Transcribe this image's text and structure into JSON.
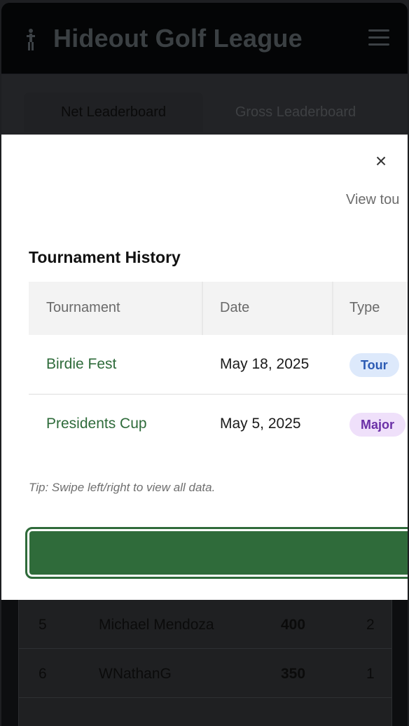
{
  "header": {
    "title": "Hideout Golf League",
    "logo_icon": "golfer-icon",
    "menu_icon": "hamburger-menu-icon"
  },
  "tabs": [
    {
      "label": "Net Leaderboard",
      "active": true
    },
    {
      "label": "Gross Leaderboard",
      "active": false
    }
  ],
  "leaderboard": {
    "rows": [
      {
        "rank": "5",
        "name": "Michael Mendoza",
        "points": "400",
        "events": "2"
      },
      {
        "rank": "6",
        "name": "WNathanG",
        "points": "350",
        "events": "1"
      }
    ]
  },
  "modal": {
    "close_symbol": "×",
    "view_link": "View tou",
    "section_title": "Tournament History",
    "columns": [
      "Tournament",
      "Date",
      "Type"
    ],
    "rows": [
      {
        "tournament": "Birdie Fest",
        "date": "May 18, 2025",
        "type": "Tour"
      },
      {
        "tournament": "Presidents Cup",
        "date": "May 5, 2025",
        "type": "Major"
      }
    ],
    "tip": "Tip: Swipe left/right to view all data.",
    "colors": {
      "accent": "#2f6b3a",
      "tour_badge": "#dde9fb",
      "major_badge": "#efe0fa"
    }
  }
}
